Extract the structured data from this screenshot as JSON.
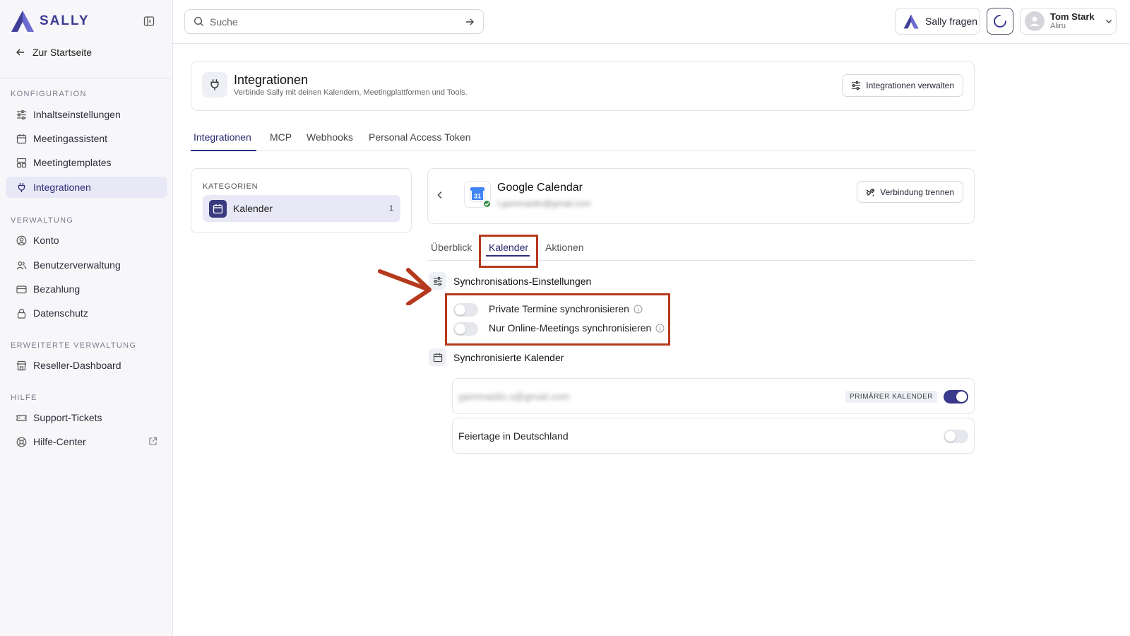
{
  "sidebar": {
    "brand": "SALLY",
    "back_label": "Zur Startseite",
    "sections": {
      "konfiguration": "KONFIGURATION",
      "verwaltung": "VERWALTUNG",
      "erweitert": "ERWEITERTE VERWALTUNG",
      "hilfe": "HILFE"
    },
    "items": {
      "inhaltseinstellungen": "Inhaltseinstellungen",
      "meetingassistent": "Meetingassistent",
      "meetingtemplates": "Meetingtemplates",
      "integrationen": "Integrationen",
      "konto": "Konto",
      "benutzerverwaltung": "Benutzerverwaltung",
      "bezahlung": "Bezahlung",
      "datenschutz": "Datenschutz",
      "reseller": "Reseller-Dashboard",
      "support": "Support-Tickets",
      "hilfecenter": "Hilfe-Center"
    }
  },
  "topbar": {
    "search_placeholder": "Suche",
    "sally_button": "Sally fragen",
    "user_name": "Tom Stark",
    "user_org": "Aliru"
  },
  "header": {
    "title": "Integrationen",
    "subtitle": "Verbinde Sally mit deinen Kalendern, Meetingplattformen und Tools.",
    "manage_button": "Integrationen verwalten"
  },
  "tabs": [
    "Integrationen",
    "MCP",
    "Webhooks",
    "Personal Access Token"
  ],
  "categories": {
    "label": "KATEGORIEN",
    "item": "Kalender",
    "count": "1"
  },
  "provider": {
    "title": "Google Calendar",
    "email": "t.gammaidio@gmail.com",
    "disconnect_button": "Verbindung trennen",
    "icon_label": "31"
  },
  "sub_tabs": [
    "Überblick",
    "Kalender",
    "Aktionen"
  ],
  "sync": {
    "title": "Synchronisations-Einstellungen",
    "opt_private": "Private Termine synchronisieren",
    "opt_online": "Nur Online-Meetings synchronisieren",
    "private_enabled": false,
    "online_enabled": false
  },
  "calendars": {
    "title": "Synchronisierte Kalender",
    "primary_email": "gammaidio.s@gmail.com",
    "primary_badge": "PRIMÄRER KALENDER",
    "primary_enabled": true,
    "holiday_name": "Feiertage in Deutschland",
    "holiday_enabled": false
  },
  "colors": {
    "accent": "#2f2f84",
    "annotation": "#b5391c",
    "active_bg": "#e8e8f6",
    "success": "#2f8a45"
  }
}
